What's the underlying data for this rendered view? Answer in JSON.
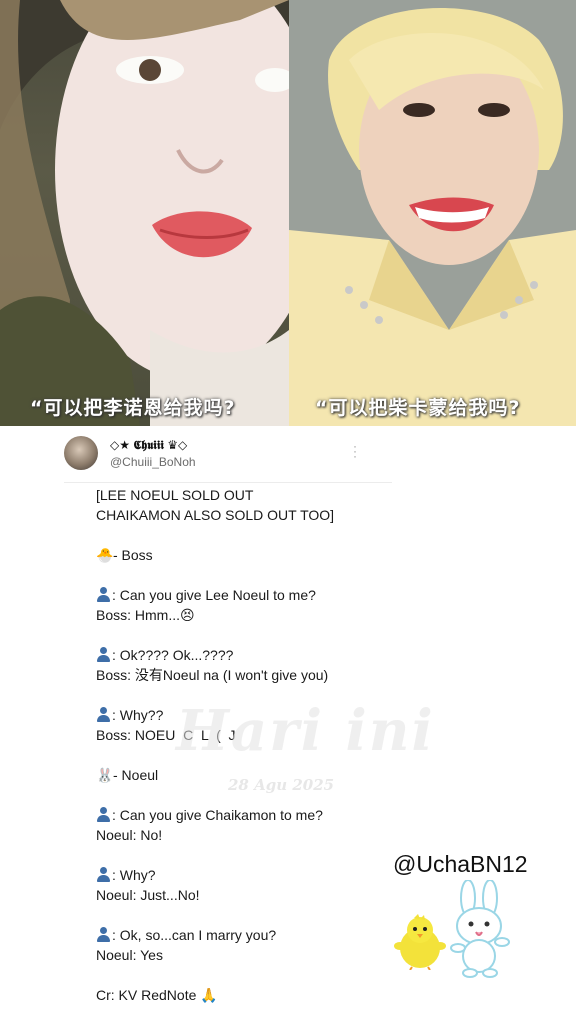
{
  "photos": {
    "left_caption": "“可以把李诺恩给我吗?",
    "right_caption": "“可以把柴卡蒙给我吗?"
  },
  "tweet": {
    "display_name": "◇★ 𝕮𝖍𝖚𝖎𝖎𝖎 ♛◇",
    "handle": "@Chuiii_BoNoh",
    "lines": [
      {
        "text": "[LEE NOEUL SOLD OUT"
      },
      {
        "text": "CHAIKAMON ALSO SOLD OUT TOO]"
      },
      {
        "text": ""
      },
      {
        "icon": "🐣",
        "text": "- Boss"
      },
      {
        "text": ""
      },
      {
        "icon": "person",
        "text": ": Can you give Lee Noeul to me?"
      },
      {
        "text": "Boss: Hmm...😣"
      },
      {
        "text": ""
      },
      {
        "icon": "person",
        "text": ": Ok???? Ok...????"
      },
      {
        "text": "Boss: 没有Noeul na (I won't give you)"
      },
      {
        "text": ""
      },
      {
        "icon": "person",
        "text": ": Why??"
      },
      {
        "text": "Boss: NOEU  C  L  (  J"
      },
      {
        "text": ""
      },
      {
        "icon": "🐰",
        "text": "- Noeul"
      },
      {
        "text": ""
      },
      {
        "icon": "person",
        "text": ": Can you give Chaikamon to me?"
      },
      {
        "text": "Noeul: No!"
      },
      {
        "text": ""
      },
      {
        "icon": "person",
        "text": ": Why?"
      },
      {
        "text": "Noeul: Just...No!"
      },
      {
        "text": ""
      },
      {
        "icon": "person",
        "text": ": Ok, so...can I marry you?"
      },
      {
        "text": "Noeul: Yes"
      },
      {
        "text": ""
      },
      {
        "text": "Cr: KV RedNote 🙏"
      }
    ]
  },
  "overlay": {
    "watermark": "Hari ini",
    "watermark_date": "28 Agu 2025",
    "credit": "@UchaBN12"
  },
  "icons": [
    "more-icon",
    "person-icon",
    "chick-icon",
    "rabbit-icon",
    "pray-icon"
  ]
}
